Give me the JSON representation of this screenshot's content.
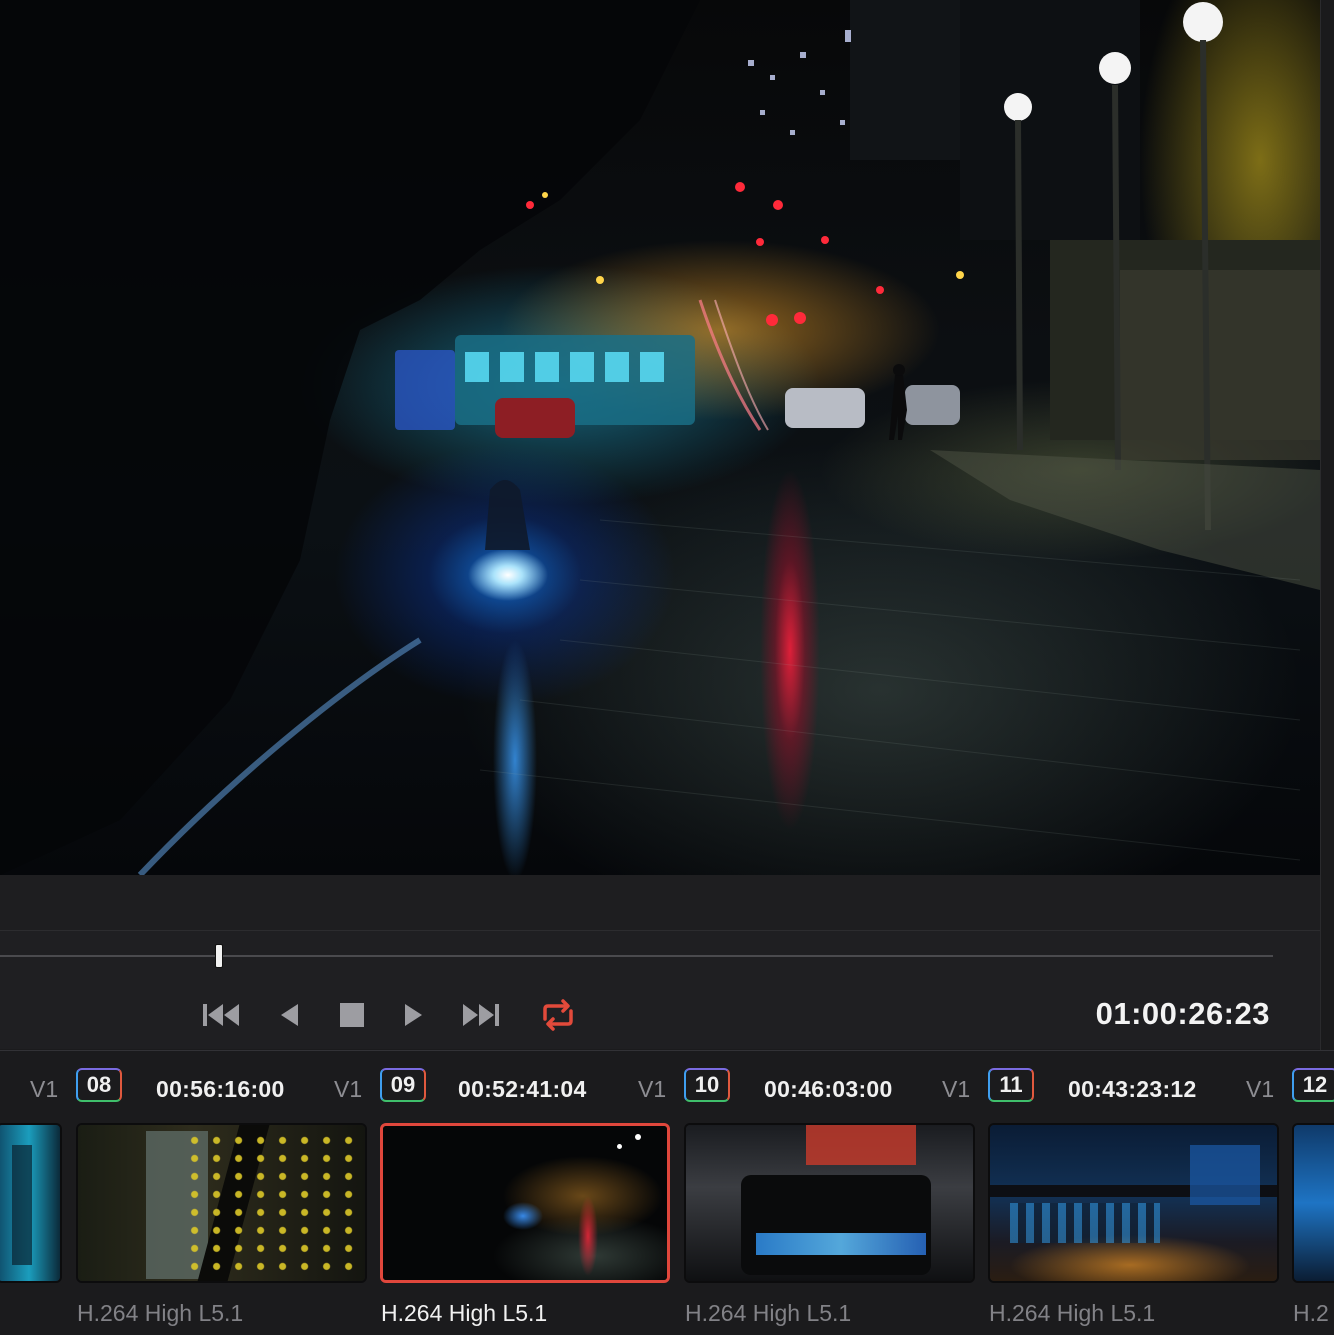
{
  "viewer": {
    "description_icon": "video-frame"
  },
  "transport": {
    "timecode": "01:00:26:23",
    "scrub_position": 0.17,
    "controls": [
      {
        "name": "go-to-start",
        "icon": "skip-to-start-icon"
      },
      {
        "name": "play-reverse",
        "icon": "play-reverse-icon"
      },
      {
        "name": "stop",
        "icon": "stop-icon"
      },
      {
        "name": "play",
        "icon": "play-icon"
      },
      {
        "name": "go-to-end",
        "icon": "skip-to-end-icon"
      },
      {
        "name": "loop",
        "icon": "loop-icon",
        "active": true,
        "color": "#e24a3b"
      }
    ]
  },
  "clips": [
    {
      "track": "V1",
      "number": "08",
      "timecode": "00:56:16:00",
      "codec": "H.264 High L5.1",
      "selected": false
    },
    {
      "track": "V1",
      "number": "09",
      "timecode": "00:52:41:04",
      "codec": "H.264 High L5.1",
      "selected": true
    },
    {
      "track": "V1",
      "number": "10",
      "timecode": "00:46:03:00",
      "codec": "H.264 High L5.1",
      "selected": false
    },
    {
      "track": "V1",
      "number": "11",
      "timecode": "00:43:23:12",
      "codec": "H.264 High L5.1",
      "selected": false
    },
    {
      "track": "V1",
      "number": "12",
      "timecode": "",
      "codec": "H.2",
      "selected": false
    }
  ],
  "colors": {
    "accent_red": "#e0473c",
    "number_badge_gradient": [
      "#3fa9f5",
      "#c94be0",
      "#f0a43a",
      "#3fd36b"
    ]
  }
}
